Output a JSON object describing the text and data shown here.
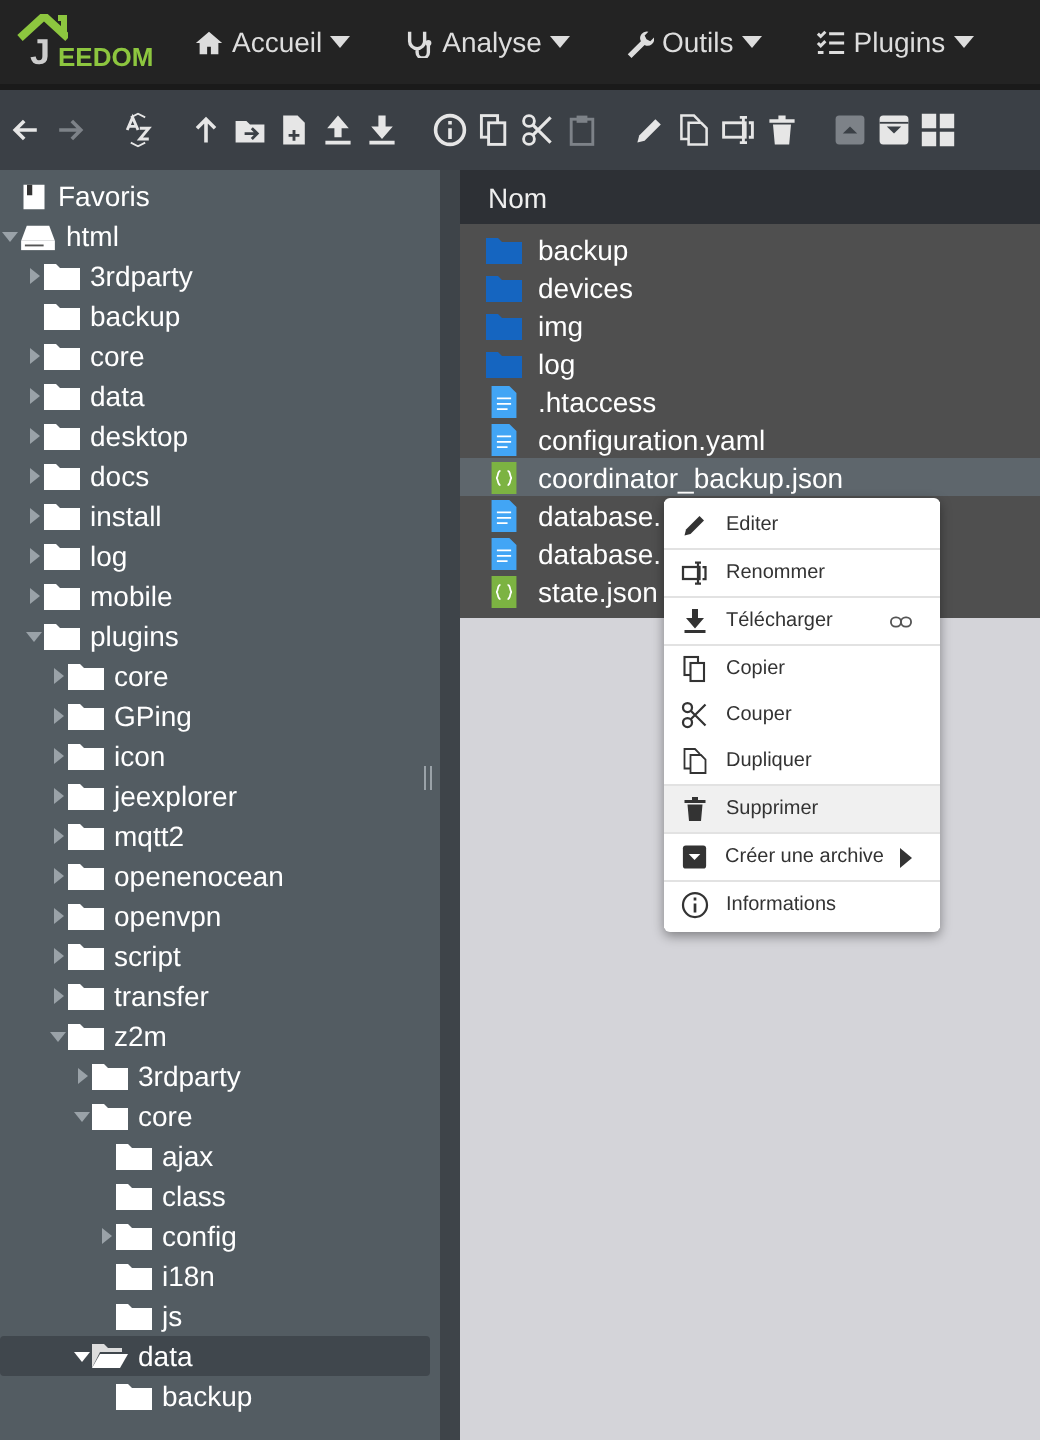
{
  "navbar": {
    "logo": {
      "mark": "J",
      "text": "EEDOM"
    },
    "menus": [
      {
        "label": "Accueil"
      },
      {
        "label": "Analyse"
      },
      {
        "label": "Outils"
      },
      {
        "label": "Plugins"
      }
    ]
  },
  "toolbar": [
    {
      "kind": "back",
      "disabled": false
    },
    {
      "kind": "forward",
      "disabled": true
    },
    {
      "kind": "sort",
      "disabled": false
    },
    {
      "kind": "up",
      "disabled": false
    },
    {
      "kind": "move",
      "disabled": false
    },
    {
      "kind": "newfile",
      "disabled": false
    },
    {
      "kind": "upload",
      "disabled": false
    },
    {
      "kind": "download",
      "disabled": false
    },
    {
      "kind": "info",
      "disabled": false
    },
    {
      "kind": "copy",
      "disabled": false
    },
    {
      "kind": "cut",
      "disabled": false
    },
    {
      "kind": "paste",
      "disabled": true
    },
    {
      "kind": "edit",
      "disabled": false
    },
    {
      "kind": "duplicate",
      "disabled": false
    },
    {
      "kind": "rename",
      "disabled": false
    },
    {
      "kind": "delete",
      "disabled": false
    },
    {
      "kind": "unarchive",
      "disabled": true
    },
    {
      "kind": "archive",
      "disabled": false
    },
    {
      "kind": "grid",
      "disabled": false
    }
  ],
  "tree": [
    {
      "label": "Favoris",
      "kind": "favorites",
      "selected": false
    },
    {
      "label": "html",
      "kind": "drive",
      "expanded": true,
      "selected": false,
      "children": [
        {
          "label": "3rdparty",
          "kind": "folder",
          "expanded": false,
          "selected": false
        },
        {
          "label": "backup",
          "kind": "folder",
          "selected": false
        },
        {
          "label": "core",
          "kind": "folder",
          "expanded": false,
          "selected": false
        },
        {
          "label": "data",
          "kind": "folder",
          "expanded": false,
          "selected": false
        },
        {
          "label": "desktop",
          "kind": "folder",
          "expanded": false,
          "selected": false
        },
        {
          "label": "docs",
          "kind": "folder",
          "expanded": false,
          "selected": false
        },
        {
          "label": "install",
          "kind": "folder",
          "expanded": false,
          "selected": false
        },
        {
          "label": "log",
          "kind": "folder",
          "expanded": false,
          "selected": false
        },
        {
          "label": "mobile",
          "kind": "folder",
          "expanded": false,
          "selected": false
        },
        {
          "label": "plugins",
          "kind": "folder",
          "expanded": true,
          "selected": false,
          "children": [
            {
              "label": "core",
              "kind": "folder",
              "expanded": false,
              "selected": false
            },
            {
              "label": "GPing",
              "kind": "folder",
              "expanded": false,
              "selected": false
            },
            {
              "label": "icon",
              "kind": "folder",
              "expanded": false,
              "selected": false
            },
            {
              "label": "jeexplorer",
              "kind": "folder",
              "expanded": false,
              "selected": false
            },
            {
              "label": "mqtt2",
              "kind": "folder",
              "expanded": false,
              "selected": false
            },
            {
              "label": "openenocean",
              "kind": "folder",
              "expanded": false,
              "selected": false
            },
            {
              "label": "openvpn",
              "kind": "folder",
              "expanded": false,
              "selected": false
            },
            {
              "label": "script",
              "kind": "folder",
              "expanded": false,
              "selected": false
            },
            {
              "label": "transfer",
              "kind": "folder",
              "expanded": false,
              "selected": false
            },
            {
              "label": "z2m",
              "kind": "folder",
              "expanded": true,
              "selected": false,
              "children": [
                {
                  "label": "3rdparty",
                  "kind": "folder",
                  "expanded": false,
                  "selected": false
                },
                {
                  "label": "core",
                  "kind": "folder",
                  "expanded": true,
                  "selected": false,
                  "children": [
                    {
                      "label": "ajax",
                      "kind": "folder",
                      "selected": false
                    },
                    {
                      "label": "class",
                      "kind": "folder",
                      "selected": false
                    },
                    {
                      "label": "config",
                      "kind": "folder",
                      "expanded": false,
                      "selected": false
                    },
                    {
                      "label": "i18n",
                      "kind": "folder",
                      "selected": false
                    },
                    {
                      "label": "js",
                      "kind": "folder",
                      "selected": false
                    }
                  ]
                },
                {
                  "label": "data",
                  "kind": "folder",
                  "expanded": true,
                  "selected": true,
                  "children": [
                    {
                      "label": "backup",
                      "kind": "folder",
                      "selected": false
                    }
                  ]
                }
              ]
            }
          ]
        }
      ]
    }
  ],
  "files": {
    "column": "Nom",
    "rows": [
      {
        "name": "backup",
        "kind": "folder",
        "selected": false
      },
      {
        "name": "devices",
        "kind": "folder",
        "selected": false
      },
      {
        "name": "img",
        "kind": "folder",
        "selected": false
      },
      {
        "name": "log",
        "kind": "folder",
        "selected": false
      },
      {
        "name": ".htaccess",
        "kind": "text",
        "selected": false
      },
      {
        "name": "configuration.yaml",
        "kind": "text",
        "selected": false
      },
      {
        "name": "coordinator_backup.json",
        "kind": "json",
        "selected": true
      },
      {
        "name": "database.",
        "kind": "text",
        "selected": false
      },
      {
        "name": "database.",
        "kind": "text",
        "selected": false
      },
      {
        "name": "state.json",
        "kind": "json",
        "selected": false
      }
    ]
  },
  "context_menu": [
    {
      "label": "Editer",
      "kind": "plain",
      "selected": false,
      "separated": true
    },
    {
      "label": "Renommer",
      "kind": "plain",
      "selected": false,
      "separated": true
    },
    {
      "label": "Télécharger",
      "kind": "link",
      "selected": false,
      "separated": true
    },
    {
      "label": "Copier",
      "kind": "plain",
      "selected": false,
      "separated": false
    },
    {
      "label": "Couper",
      "kind": "plain",
      "selected": false,
      "separated": false
    },
    {
      "label": "Dupliquer",
      "kind": "plain",
      "selected": false,
      "separated": true
    },
    {
      "label": "Supprimer",
      "kind": "plain",
      "selected": true,
      "separated": true
    },
    {
      "label": "Créer une archive",
      "kind": "submenu",
      "selected": false,
      "separated": true
    },
    {
      "label": "Informations",
      "kind": "plain",
      "selected": false,
      "separated": false
    }
  ]
}
